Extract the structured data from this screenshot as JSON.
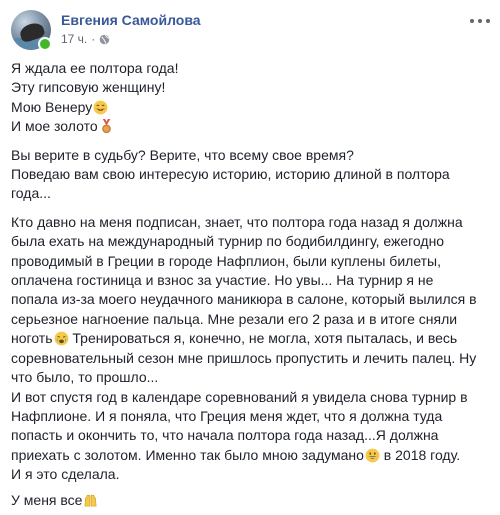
{
  "post": {
    "author": "Евгения Самойлова",
    "time": "17 ч.",
    "separator": "·",
    "privacy_icon": "globe-icon",
    "more_icon": "more-options-icon"
  },
  "body": {
    "p1": [
      "Я ждала ее полтора года!",
      "Эту гипсовую женщину!",
      "Мою Венеру",
      "И мое золото"
    ],
    "p2": [
      "Вы верите в судьбу? Верите, что всему свое время?",
      "Поведаю вам свою интересую историю, историю длиной в полтора",
      "года..."
    ],
    "p3": [
      "Кто давно на меня подписан, знает, что полтора года назад я должна",
      "была ехать на международный турнир по бодибилдингу, ежегодно",
      "проводимый в Греции в городе Нафплион, были куплены билеты,",
      "оплачена гостиница и взнос за участие. Но увы... На турнир я не",
      "попала из-за моего неудачного маникюра в салоне, который вылился в",
      "серьезное нагноение пальца. Мне резали его 2 раза и в итоге сняли",
      "ноготь",
      " Тренироваться я, конечно, не могла, хотя пыталась, и весь",
      "соревновательный сезон мне пришлось пропустить и лечить палец. Ну",
      "что было, то прошло...",
      "И вот спустя год в календаре соревнований я увидела снова турнир в",
      "Нафплионе. И я поняла, что Греция меня ждет, что я должна туда",
      "попасть и окончить то, что начала полтора года назад...Я должна",
      "приехать с золотом. Именно так было мною задумано",
      " в 2018 году.",
      "И я это сделала."
    ],
    "p4": "У меня все",
    "emojis": {
      "smile": "smiling-face-icon",
      "medal": "medal-icon",
      "cry": "crying-face-icon",
      "grin": "grinning-face-icon",
      "hands": "raising-hands-icon"
    }
  }
}
